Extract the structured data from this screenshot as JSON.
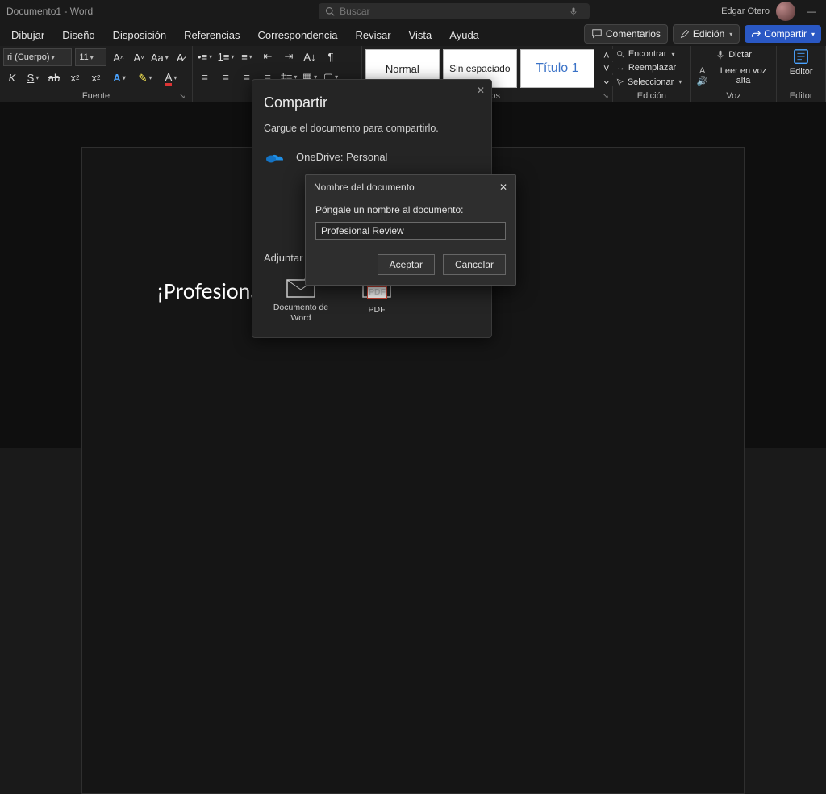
{
  "title_bar": {
    "doc_title": "Documento1 - Word",
    "search_placeholder": "Buscar",
    "user_name": "Edgar Otero"
  },
  "menu": {
    "items": [
      "Dibujar",
      "Diseño",
      "Disposición",
      "Referencias",
      "Correspondencia",
      "Revisar",
      "Vista",
      "Ayuda"
    ]
  },
  "top_right": {
    "comments": "Comentarios",
    "edit": "Edición",
    "share": "Compartir"
  },
  "ribbon": {
    "font": {
      "name": "ri (Cuerpo)",
      "size": "11",
      "label": "Fuente"
    },
    "styles": {
      "label": "Estilos",
      "items": [
        "Normal",
        "Sin espaciado",
        "Título 1"
      ]
    },
    "edit": {
      "find": "Encontrar",
      "replace": "Reemplazar",
      "select": "Seleccionar",
      "label": "Edición"
    },
    "voice": {
      "dictate": "Dictar",
      "read": "Leer en voz alta",
      "label": "Voz"
    },
    "editor": {
      "label": "Editor",
      "button": "Editor"
    }
  },
  "page_content": "¡Profesional Revie",
  "share_panel": {
    "title": "Compartir",
    "upload_msg": "Cargue el documento para compartirlo.",
    "onedrive": "OneDrive: Personal",
    "attach_hdr": "Adjuntar una copia en su lugar",
    "word_doc": "Documento de Word",
    "pdf": "PDF"
  },
  "name_dialog": {
    "title": "Nombre del documento",
    "prompt": "Póngale un nombre al documento:",
    "value": "Profesional Review",
    "ok": "Aceptar",
    "cancel": "Cancelar"
  }
}
